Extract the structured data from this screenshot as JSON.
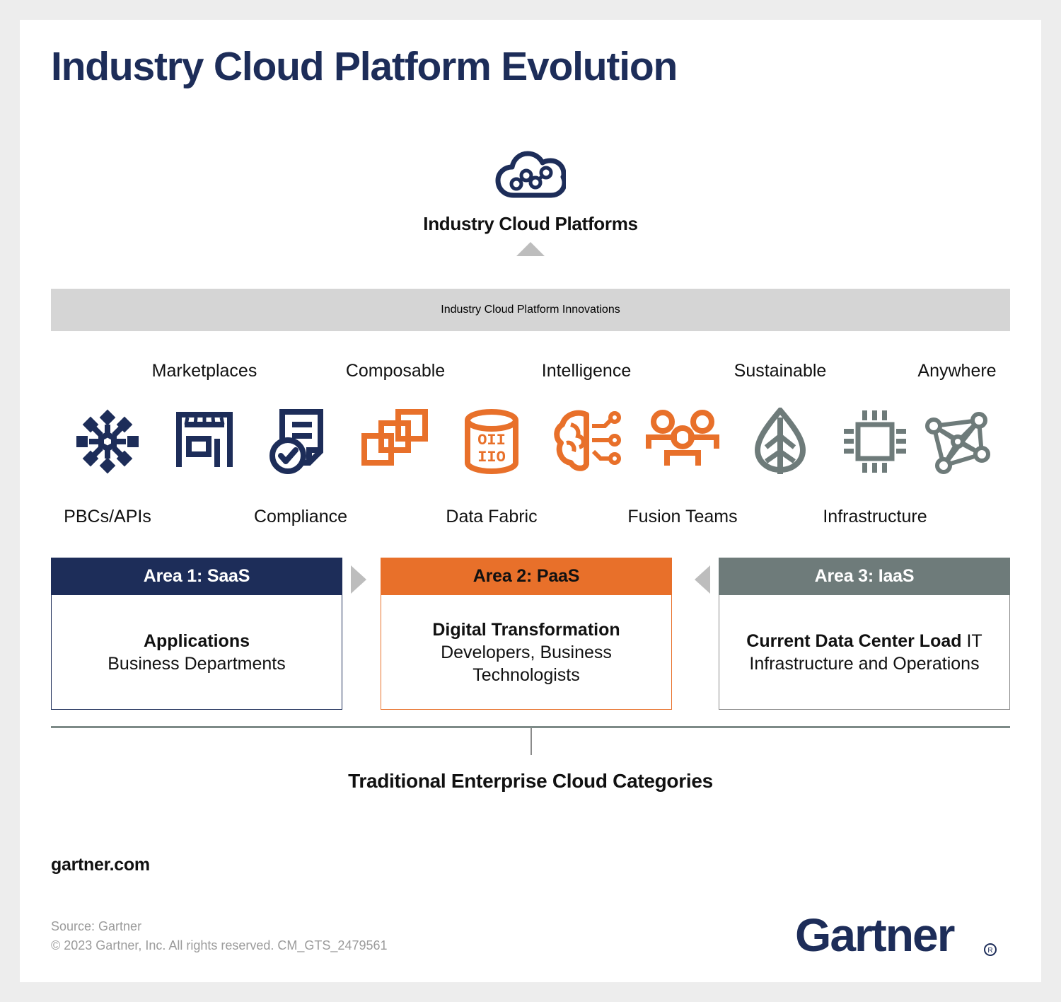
{
  "page": {
    "title": "Industry Cloud Platform Evolution",
    "accent_navy": "#1d2d59",
    "accent_orange": "#e8702a",
    "accent_gray": "#6e7b7a",
    "band_gray": "#d5d5d5",
    "page_background": "#ededed"
  },
  "cloud": {
    "icon": "cloud-network-icon",
    "caption": "Industry Cloud Platforms"
  },
  "innovations": {
    "band_label": "Industry Cloud Platform Innovations",
    "columns": [
      {
        "top_label": "",
        "icon": "hub-spoke-api-icon",
        "icon_color": "#1d2d59",
        "bottom_label": "PBCs/APIs"
      },
      {
        "top_label": "Marketplaces",
        "icon": "storefront-icon",
        "icon_color": "#1d2d59",
        "bottom_label": ""
      },
      {
        "top_label": "",
        "icon": "document-check-icon",
        "icon_color": "#1d2d59",
        "bottom_label": "Compliance"
      },
      {
        "top_label": "Composable",
        "icon": "stacked-squares-icon",
        "icon_color": "#e8702a",
        "bottom_label": ""
      },
      {
        "top_label": "",
        "icon": "database-binary-icon",
        "icon_color": "#e8702a",
        "bottom_label": "Data Fabric"
      },
      {
        "top_label": "Intelligence",
        "icon": "brain-circuit-icon",
        "icon_color": "#e8702a",
        "bottom_label": ""
      },
      {
        "top_label": "",
        "icon": "people-group-icon",
        "icon_color": "#e8702a",
        "bottom_label": "Fusion Teams"
      },
      {
        "top_label": "Sustainable",
        "icon": "leaf-icon",
        "icon_color": "#6e7b7a",
        "bottom_label": ""
      },
      {
        "top_label": "",
        "icon": "cpu-chip-icon",
        "icon_color": "#6e7b7a",
        "bottom_label": "Infrastructure"
      },
      {
        "top_label": "Anywhere",
        "icon": "network-mesh-icon",
        "icon_color": "#6e7b7a",
        "bottom_label": ""
      }
    ]
  },
  "areas": [
    {
      "header": "Area 1: SaaS",
      "header_bg": "#1d2d59",
      "header_color": "#ffffff",
      "border_color": "#1d2d59",
      "body_bold": "Applications",
      "body_text": "Business Departments"
    },
    {
      "header": "Area 2: PaaS",
      "header_bg": "#e8702a",
      "header_color": "#111111",
      "border_color": "#e8702a",
      "body_bold": "Digital Transformation",
      "body_text": "Developers, Business Technologists"
    },
    {
      "header": "Area 3: IaaS",
      "header_bg": "#6e7b7a",
      "header_color": "#ffffff",
      "border_color": "#8a8a8a",
      "body_bold": "Current Data Center Load",
      "body_text": "IT Infrastructure and Operations"
    }
  ],
  "bracket": {
    "label": "Traditional Enterprise Cloud Categories"
  },
  "footer": {
    "site": "gartner.com",
    "source": "Source: Gartner",
    "copyright": "© 2023 Gartner, Inc. All rights reserved. CM_GTS_2479561",
    "logo": "gartner-logo"
  }
}
